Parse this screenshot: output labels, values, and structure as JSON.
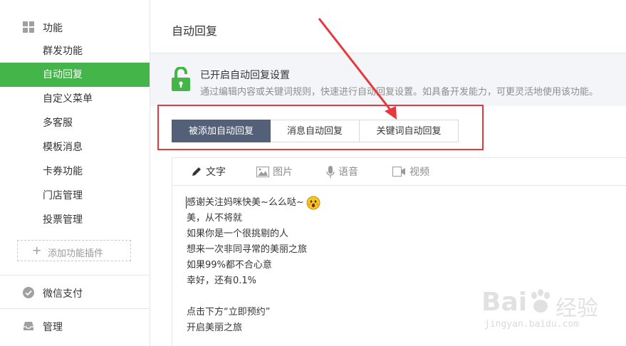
{
  "sidebar": {
    "section_function": "功能",
    "items": [
      {
        "label": "群发功能",
        "active": false
      },
      {
        "label": "自动回复",
        "active": true
      },
      {
        "label": "自定义菜单",
        "active": false
      },
      {
        "label": "多客服",
        "active": false
      },
      {
        "label": "模板消息",
        "active": false
      },
      {
        "label": "卡券功能",
        "active": false
      },
      {
        "label": "门店管理",
        "active": false
      },
      {
        "label": "投票管理",
        "active": false
      }
    ],
    "add_plugin": "添加功能插件",
    "section_pay": "微信支付",
    "section_manage": "管理"
  },
  "main": {
    "title": "自动回复",
    "notice": {
      "title": "已开启自动回复设置",
      "desc": "通过编辑内容或关键词规则，快速进行自动回复设置。如具备开发能力，可更灵活地使用该功能。"
    },
    "tabs": [
      "被添加自动回复",
      "消息自动回复",
      "关键词自动回复"
    ],
    "editor_tools": [
      "文字",
      "图片",
      "语音",
      "视频"
    ],
    "content_lines": [
      "感谢关注妈咪快美~么么哒~",
      "美，从不将就",
      "如果你是一个很挑剔的人",
      "想来一次非同寻常的美丽之旅",
      "如果99%都不合心意",
      "幸好，还有0.1%",
      "",
      "点击下方“立即预约”",
      "开启美丽之旅"
    ]
  },
  "watermark": {
    "brand": "Bai",
    "cn": "经验",
    "url": "jingyan.baidu.com"
  },
  "colors": {
    "accent": "#44b549",
    "tab_active": "#536078",
    "highlight": "#e6393d"
  }
}
